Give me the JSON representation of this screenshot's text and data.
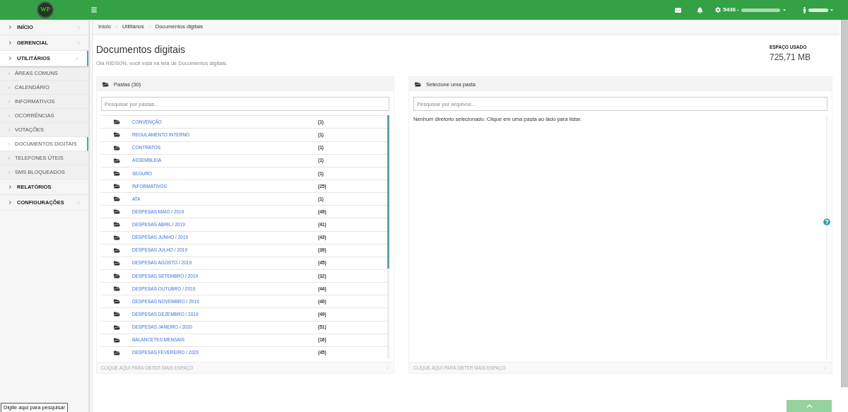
{
  "topbar": {
    "logo": "WP",
    "condo": {
      "code": "5436 -"
    }
  },
  "sidebar": {
    "items": [
      {
        "label": "INÍCIO",
        "expanded": false,
        "selected": false,
        "has_submenu": true
      },
      {
        "label": "GERENCIAL",
        "expanded": false,
        "selected": false,
        "has_submenu": true
      },
      {
        "label": "UTILITÁRIOS",
        "expanded": true,
        "selected": true,
        "has_submenu": true,
        "children": [
          {
            "label": "ÁREAS COMUNS",
            "selected": false
          },
          {
            "label": "CALENDÁRIO",
            "selected": false
          },
          {
            "label": "INFORMATIVOS",
            "selected": false
          },
          {
            "label": "OCORRÊNCIAS",
            "selected": false
          },
          {
            "label": "VOTAÇÕES",
            "selected": false
          },
          {
            "label": "DOCUMENTOS DIGITAIS",
            "selected": true
          },
          {
            "label": "TELEFONES ÚTEIS",
            "selected": false
          },
          {
            "label": "SMS BLOQUEADOS",
            "selected": false
          }
        ]
      },
      {
        "label": "RELATÓRIOS",
        "expanded": false,
        "selected": false,
        "has_submenu": false
      },
      {
        "label": "CONFIGURAÇÕES",
        "expanded": false,
        "selected": false,
        "has_submenu": true
      }
    ]
  },
  "breadcrumb": [
    "Início",
    "Utilitários",
    "Documentos digitais"
  ],
  "page": {
    "title": "Documentos digitais",
    "subtitle": "Olá RIDSON, você está na tela de Documentos digitais.",
    "usage": {
      "label": "ESPAÇO USADO",
      "value": "725,71 MB"
    }
  },
  "folders_panel": {
    "title": "Pastas (30)",
    "search": {
      "placeholder": "Pesquisar por pastas..."
    },
    "footer": "CLIQUE AQUI PARA OBTER MAIS ESPAÇO",
    "folders": [
      {
        "name": "CONVENÇÃO",
        "count": "(1)"
      },
      {
        "name": "REGULAMENTO INTERNO",
        "count": "(1)"
      },
      {
        "name": "CONTRATOS",
        "count": "(1)"
      },
      {
        "name": "ASSEMBLEIA",
        "count": "(1)"
      },
      {
        "name": "SEGURO",
        "count": "(1)"
      },
      {
        "name": "INFORMATIVOS",
        "count": "(25)"
      },
      {
        "name": "ATA",
        "count": "(1)"
      },
      {
        "name": "DESPESAS MAIO / 2019",
        "count": "(49)"
      },
      {
        "name": "DESPESAS ABRIL / 2019",
        "count": "(41)"
      },
      {
        "name": "DESPESAS JUNHO / 2019",
        "count": "(43)"
      },
      {
        "name": "DESPESAS JULHO / 2019",
        "count": "(39)"
      },
      {
        "name": "DESPESAS AGOSTO / 2019",
        "count": "(45)"
      },
      {
        "name": "DESPESAS SETEMBRO / 2019",
        "count": "(32)"
      },
      {
        "name": "DESPESAS OUTUBRO / 2019",
        "count": "(44)"
      },
      {
        "name": "DESPESAS NOVEMBRO / 2019",
        "count": "(40)"
      },
      {
        "name": "DESPESAS DEZEMBRO / 2019",
        "count": "(49)"
      },
      {
        "name": "DESPESAS JANEIRO / 2020",
        "count": "(51)"
      },
      {
        "name": "BALANCETES MENSAIS",
        "count": "(16)"
      },
      {
        "name": "DESPESAS FEVEREIRO / 2020",
        "count": "(45)"
      }
    ]
  },
  "files_panel": {
    "title": "Selecione uma pasta",
    "search": {
      "placeholder": "Pesquisar por arquivos..."
    },
    "message": "Nenhum diretório selecionado. Clique em uma pasta ao lado para listar.",
    "footer": "CLIQUE AQUI PARA OBTER MAIS ESPAÇO"
  },
  "tooltip": "Digite aqui para pesquisar"
}
